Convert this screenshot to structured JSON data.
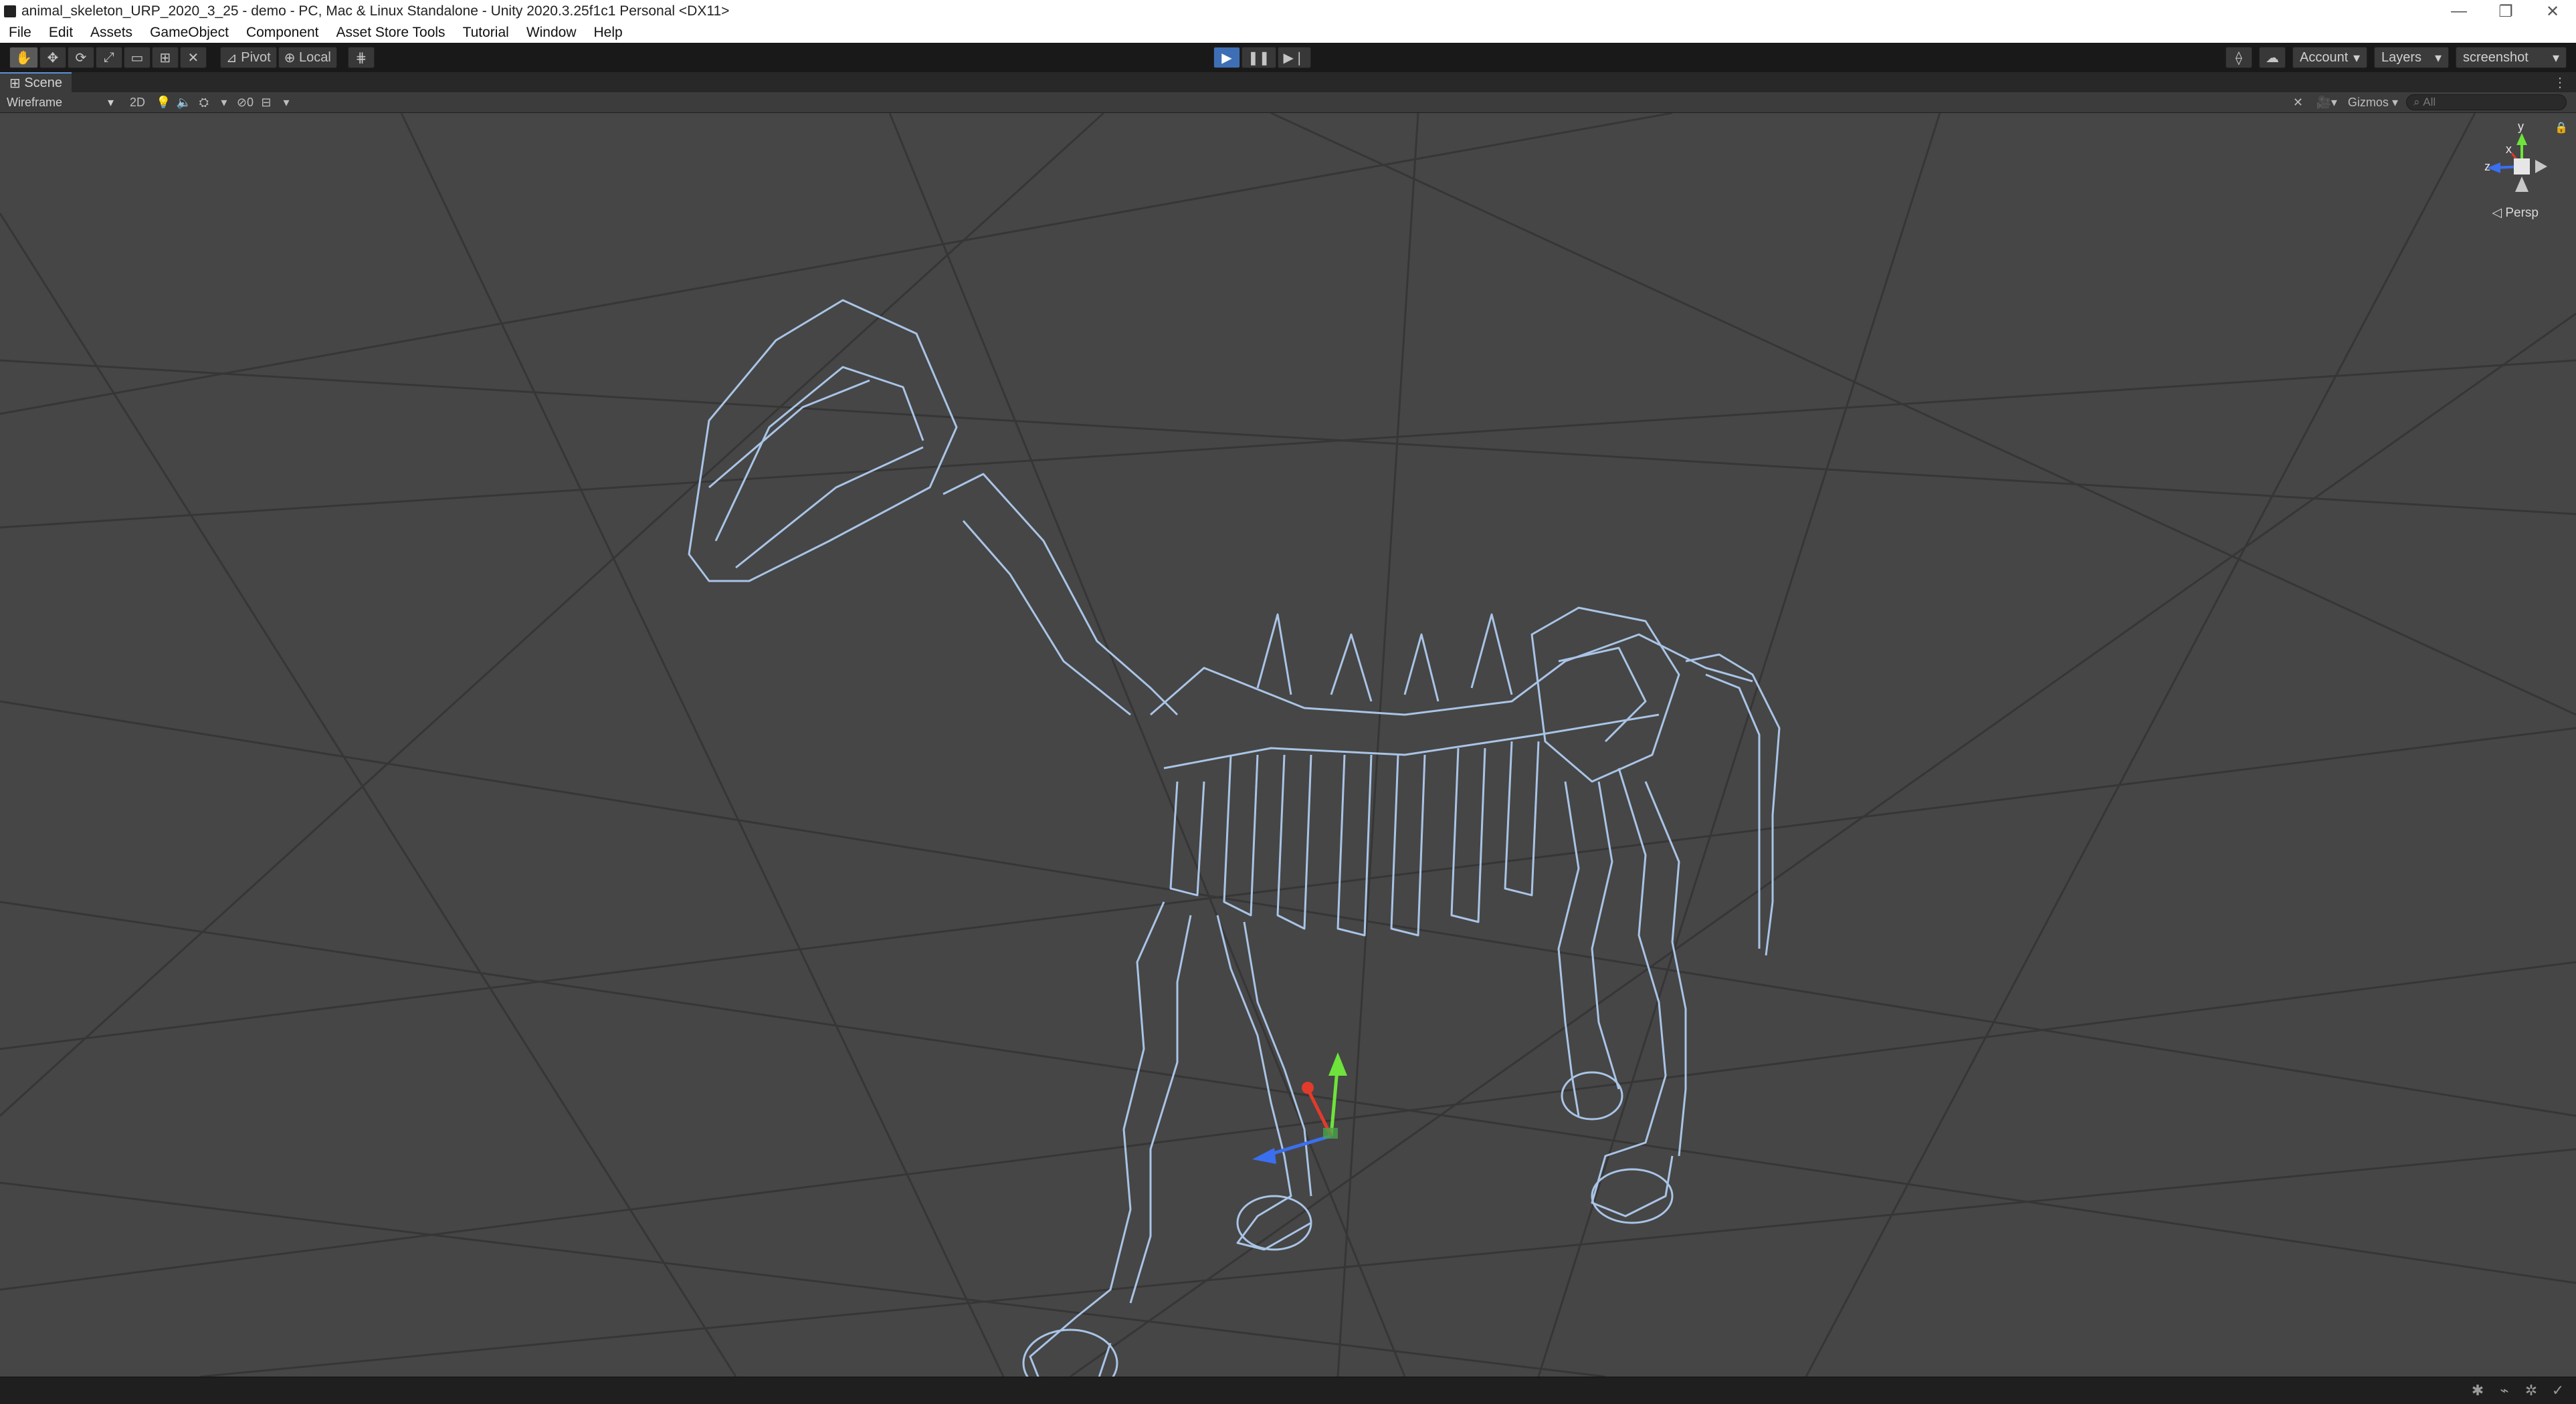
{
  "window": {
    "title": "animal_skeleton_URP_2020_3_25 - demo - PC, Mac & Linux Standalone - Unity 2020.3.25f1c1 Personal <DX11>",
    "controls": [
      "—",
      "❐",
      "✕"
    ]
  },
  "menu": [
    "File",
    "Edit",
    "Assets",
    "GameObject",
    "Component",
    "Asset Store Tools",
    "Tutorial",
    "Window",
    "Help"
  ],
  "toolbar": {
    "tools": [
      "hand-tool-icon",
      "move-tool-icon",
      "rotate-tool-icon",
      "scale-tool-icon",
      "rect-tool-icon",
      "transform-tool-icon",
      "custom-tool-icon"
    ],
    "pivot_label": "Pivot",
    "local_label": "Local",
    "account_label": "Account",
    "layers_label": "Layers",
    "layout_label": "screenshot"
  },
  "scene_tab": {
    "label": "Scene"
  },
  "scene_toolbar": {
    "draw_mode": "Wireframe",
    "mode_2d": "2D",
    "hidden_count": "0",
    "gizmos_label": "Gizmos",
    "search_placeholder": "All"
  },
  "orientation_gizmo": {
    "projection_label": "Persp",
    "axis_x": "x",
    "axis_y": "y",
    "axis_z": "z"
  },
  "colors": {
    "accent": "#3e6fb5",
    "wireframe": "#a9c4e6",
    "grid_bg": "#464646",
    "axis_x": "#e23b2b",
    "axis_y": "#6ee33b",
    "axis_z": "#3a6ff0"
  }
}
